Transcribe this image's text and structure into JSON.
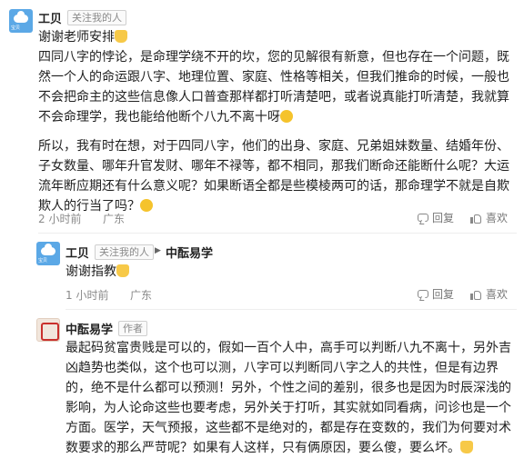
{
  "comment1": {
    "username": "工贝",
    "follow_badge": "关注我的人",
    "avatar_label": "宝贝",
    "paragraphs": [
      "谢谢老师安排",
      "四同八字的悖论，是命理学绕不开的坎，您的见解很有新意，但也存在一个问题，既然一个人的命运跟八字、地理位置、家庭、性格等相关，但我们推命的时候，一般也不会把命主的这些信息像人口普查那样都打听清楚吧，或者说真能打听清楚，我就算不会命理学，我也能给他断个八九不离十呀",
      "所以，我有时在想，对于四同八字，他们的出身、家庭、兄弟姐妹数量、结婚年份、子女数量、哪年升官发财、哪年不禄等，都不相同，那我们断命还能断什么呢？大运流年断应期还有什么意义呢？如果断语全都是些模棱两可的话，那命理学不就是自欺欺人的行当了吗？"
    ],
    "time": "2 小时前",
    "location": "广东",
    "reply_label": "回复",
    "like_label": "喜欢"
  },
  "reply1": {
    "username": "工贝",
    "follow_badge": "关注我的人",
    "avatar_label": "宝贝",
    "target": "中酝易学",
    "text": "谢谢指教",
    "time": "1 小时前",
    "location": "广东",
    "reply_label": "回复",
    "like_label": "喜欢"
  },
  "reply2": {
    "username": "中酝易学",
    "author_badge": "作者",
    "text": "最起码贫富贵贱是可以的，假如一百个人中，高手可以判断八九不离十，另外吉凶趋势也类似，这个也可以测，八字可以判断同八字之人的共性，但是有边界的，绝不是什么都可以预测！另外，个性之间的差别，很多也是因为时辰深浅的影响，为人论命这些也要考虑，另外关于打听，其实就如同看病，问诊也是一个方面。医学，天气预报，这些都不是绝对的，都是存在变数的，我们为何要对术数要求的那么严苛呢？如果有人这样，只有俩原因，要么傻，要么坏。"
  }
}
